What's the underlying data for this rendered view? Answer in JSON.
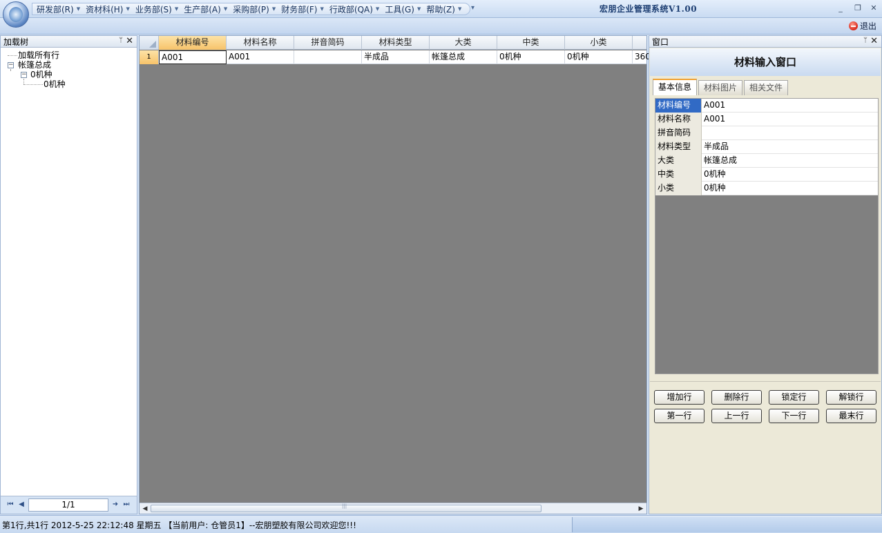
{
  "app": {
    "title": "宏朋企业管理系统V1.00",
    "exit_label": "退出"
  },
  "menu": {
    "items": [
      {
        "label": "研发部(R)"
      },
      {
        "label": "资材科(H)"
      },
      {
        "label": "业务部(S)"
      },
      {
        "label": "生产部(A)"
      },
      {
        "label": "采购部(P)"
      },
      {
        "label": "财务部(F)"
      },
      {
        "label": "行政部(QA)"
      },
      {
        "label": "工具(G)"
      },
      {
        "label": "帮助(Z)"
      }
    ],
    "more_icon": "▾"
  },
  "window_controls": {
    "minimize": "_",
    "restore": "❐",
    "close": "✕"
  },
  "left_panel": {
    "title": "加载树",
    "tree": [
      {
        "label": "加载所有行"
      },
      {
        "label": "帐篷总成"
      },
      {
        "label": "0机种"
      },
      {
        "label": "0机种"
      }
    ],
    "pager": {
      "value": "1/1"
    }
  },
  "grid": {
    "columns": [
      "材料编号",
      "材料名称",
      "拼音简码",
      "材料类型",
      "大类",
      "中类",
      "小类",
      ""
    ],
    "rows": [
      {
        "num": "1",
        "cells": [
          "A001",
          "A001",
          "",
          "半成品",
          "帐篷总成",
          "0机种",
          "0机种",
          "360"
        ]
      }
    ]
  },
  "right_panel": {
    "title": "窗口",
    "form_title": "材料输入窗口",
    "tabs": [
      {
        "label": "基本信息",
        "active": true
      },
      {
        "label": "材料图片",
        "active": false
      },
      {
        "label": "相关文件",
        "active": false
      }
    ],
    "fields": [
      {
        "label": "材料编号",
        "value": "A001"
      },
      {
        "label": "材料名称",
        "value": "A001"
      },
      {
        "label": "拼音简码",
        "value": ""
      },
      {
        "label": "材料类型",
        "value": "半成品"
      },
      {
        "label": "大类",
        "value": "帐篷总成"
      },
      {
        "label": "中类",
        "value": "0机种"
      },
      {
        "label": "小类",
        "value": "0机种"
      }
    ],
    "buttons": {
      "add_row": "增加行",
      "delete_row": "删除行",
      "lock_row": "锁定行",
      "unlock_row": "解锁行",
      "first_row": "第一行",
      "prev_row": "上一行",
      "next_row": "下一行",
      "last_row": "最末行"
    }
  },
  "status": {
    "text": "第1行,共1行 2012-5-25 22:12:48  星期五 【当前用户: 仓管员1】--宏朋塑胶有限公司欢迎您!!!"
  },
  "colors": {
    "accent": "#316ac5",
    "header_selected": "#f7c36a",
    "grid_empty": "#808080",
    "exit_red": "#d8261a"
  }
}
